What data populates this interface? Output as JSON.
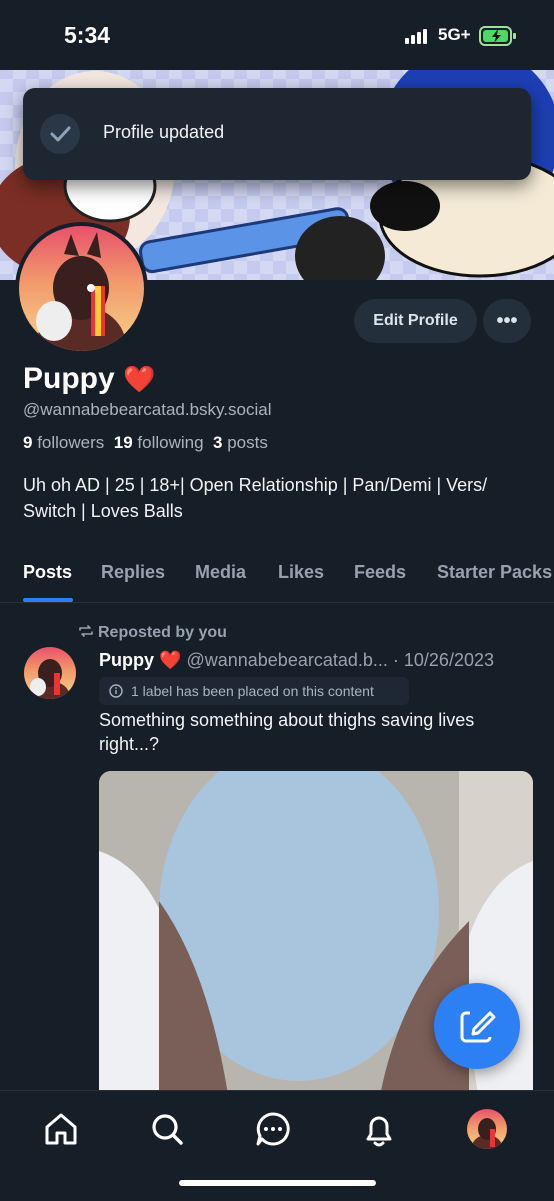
{
  "status": {
    "time": "5:34",
    "network": "5G+"
  },
  "toast": {
    "text": "Profile updated"
  },
  "profile": {
    "display_name": "Puppy",
    "emoji": "❤️",
    "handle": "@wannabebearcatad.bsky.social",
    "followers_count": "9",
    "followers_label": "followers",
    "following_count": "19",
    "following_label": "following",
    "posts_count": "3",
    "posts_label": "posts",
    "bio_line1": "Uh oh AD | 25 | 18+| Open Relationship | Pan/Demi | Vers/",
    "bio_line2": "Switch | Loves Balls",
    "edit_label": "Edit Profile",
    "more_label": "•••"
  },
  "tabs": [
    {
      "label": "Posts"
    },
    {
      "label": "Replies"
    },
    {
      "label": "Media"
    },
    {
      "label": "Likes"
    },
    {
      "label": "Feeds"
    },
    {
      "label": "Starter Packs"
    }
  ],
  "post": {
    "repost_label": "Reposted by you",
    "author": "Puppy",
    "author_emoji": "❤️",
    "handle": "@wannabebearcatad.b...",
    "date": "· 10/26/2023",
    "label_notice": "1 label has been placed on this content",
    "text_line1": "Something something about thighs saving lives",
    "text_line2": "right...?"
  },
  "colors": {
    "accent": "#2f7ff0",
    "background": "#161e27",
    "fab": "#2d7ff4"
  },
  "nav": {
    "icons": [
      "home-icon",
      "search-icon",
      "chat-icon",
      "bell-icon",
      "profile-avatar"
    ]
  }
}
